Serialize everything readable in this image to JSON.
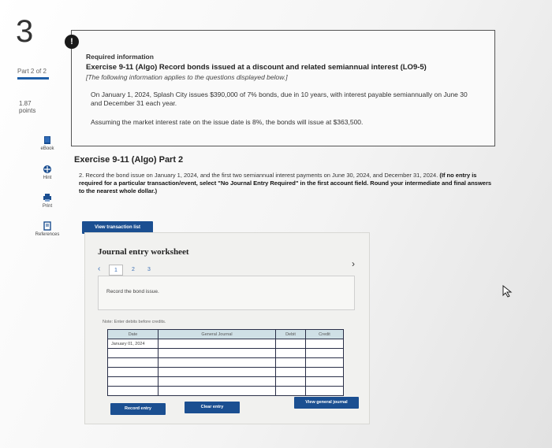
{
  "question": {
    "number": "3",
    "part_label": "Part 2 of 2",
    "points": "1.87",
    "points_label": "points"
  },
  "tools": [
    {
      "label": "eBook",
      "icon": "book-icon"
    },
    {
      "label": "Hint",
      "icon": "hint-icon"
    },
    {
      "label": "Print",
      "icon": "print-icon"
    },
    {
      "label": "References",
      "icon": "references-icon"
    }
  ],
  "info": {
    "badge": "!",
    "required": "Required information",
    "exercise": "Exercise 9-11 (Algo) Record bonds issued at a discount and related semiannual interest (LO9-5)",
    "note": "[The following information applies to the questions displayed below.]",
    "para1": "On January 1, 2024, Splash City issues $390,000 of 7% bonds, due in 10 years, with interest payable semiannually on June 30 and December 31 each year.",
    "para2": "Assuming the market interest rate on the issue date is 8%, the bonds will issue at $363,500."
  },
  "part_title": "Exercise 9-11 (Algo) Part 2",
  "instructions": {
    "text": "2. Record the bond issue on January 1, 2024, and the first two semiannual interest payments on June 30, 2024, and December 31, 2024.",
    "bold": "(If no entry is required for a particular transaction/event, select \"No Journal Entry Required\" in the first account field. Round your intermediate and final answers to the nearest whole dollar.)"
  },
  "view_transaction_list": "View transaction list",
  "worksheet": {
    "title": "Journal entry worksheet",
    "pages": [
      "1",
      "2",
      "3"
    ],
    "description": "Record the bond issue.",
    "note": "Note: Enter debits before credits.",
    "columns": [
      "Date",
      "General Journal",
      "Debit",
      "Credit"
    ],
    "rows": [
      [
        "January 01, 2024",
        "",
        "",
        ""
      ],
      [
        "",
        "",
        "",
        ""
      ],
      [
        "",
        "",
        "",
        ""
      ],
      [
        "",
        "",
        "",
        ""
      ],
      [
        "",
        "",
        "",
        ""
      ],
      [
        "",
        "",
        "",
        ""
      ]
    ],
    "record_entry": "Record entry",
    "clear_entry": "Clear entry",
    "view_general_journal": "View general journal"
  },
  "colors": {
    "accent": "#1b4f91",
    "table_header": "#cfe0e6",
    "table_border": "#2a2f48"
  }
}
